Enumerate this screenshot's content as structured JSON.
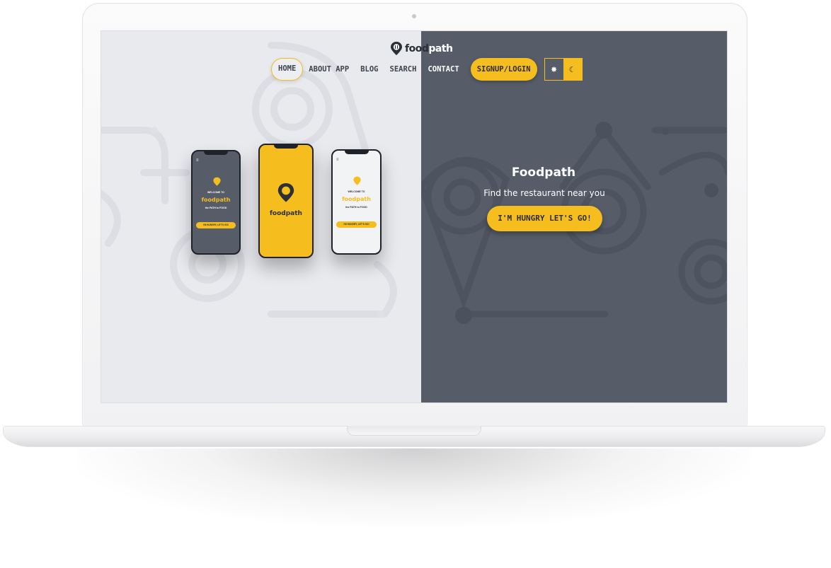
{
  "brand": {
    "logo_prefix": "food",
    "logo_suffix": "path"
  },
  "nav": {
    "items": [
      {
        "label": "HOME",
        "active": true
      },
      {
        "label": "ABOUT APP"
      },
      {
        "label": "BLOG"
      },
      {
        "label": "SEARCH"
      },
      {
        "label": "CONTACT"
      }
    ],
    "signup_label": "SIGNUP/LOGIN",
    "theme_light_icon": "sun-icon",
    "theme_dark_icon": "moon-icon"
  },
  "hero": {
    "title": "Foodpath",
    "subtitle": "Find the restaurant near you",
    "cta": "I'M HUNGRY LET'S GO!"
  },
  "phones": {
    "welcome": "WELCOME TO",
    "brand": "foodpath",
    "tagline": "the PATH to FOOD",
    "button": "I'M HUNGRY, LET'S GO!"
  },
  "colors": {
    "accent": "#f6bd1e",
    "dark": "#565d69",
    "light": "#e8eaee"
  }
}
